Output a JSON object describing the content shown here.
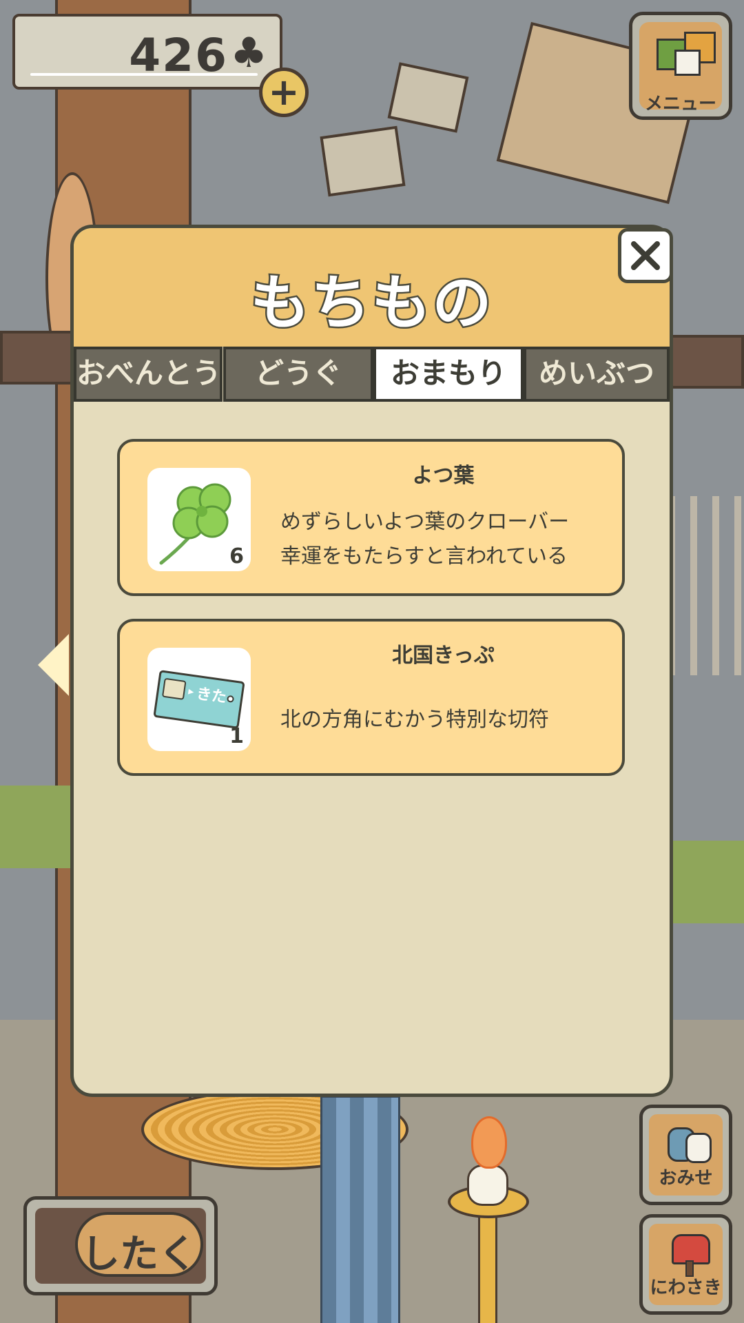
{
  "hud": {
    "clover_count": "426",
    "clover_icon": "clover-icon",
    "plus_label": "+",
    "menu_label": "メニュー",
    "shop_label": "おみせ",
    "garden_label": "にわさき",
    "prepare_label": "したく"
  },
  "modal": {
    "title": "もちもの",
    "close_icon": "close-icon",
    "tabs": [
      {
        "label": "おべんとう",
        "active": false
      },
      {
        "label": "どうぐ",
        "active": false
      },
      {
        "label": "おまもり",
        "active": true
      },
      {
        "label": "めいぶつ",
        "active": false
      }
    ],
    "items": [
      {
        "name": "よつ葉",
        "count": "6",
        "icon": "four-leaf-clover-icon",
        "desc_line1": "めずらしいよつ葉のクローバー",
        "desc_line2": "幸運をもたらすと言われている"
      },
      {
        "name": "北国きっぷ",
        "count": "1",
        "icon": "ticket-icon",
        "ticket_text": "きた",
        "desc_line1": "北の方角にむかう特別な切符"
      }
    ]
  },
  "colors": {
    "header": "#efc573",
    "panel": "#e5dcbc",
    "card": "#fedc97",
    "active_tab": "#ffffff",
    "inactive_tab": "#6c685c"
  }
}
